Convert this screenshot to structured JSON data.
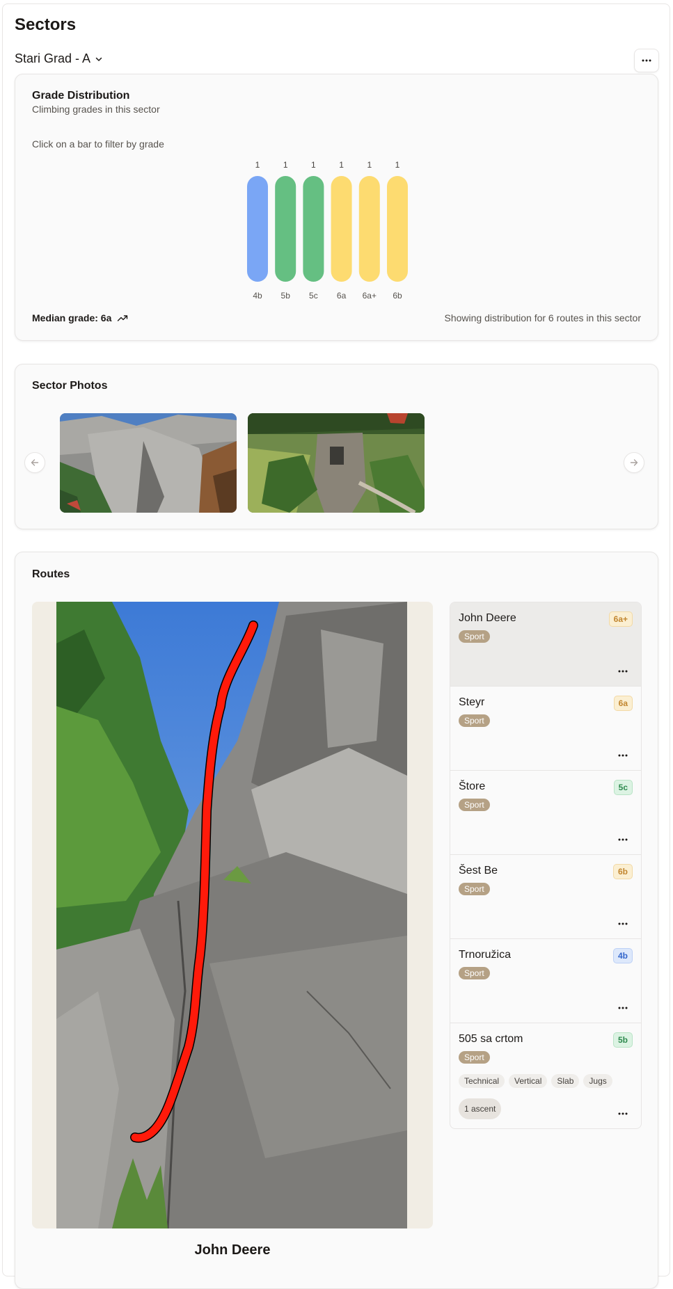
{
  "page": {
    "title": "Sectors"
  },
  "sector_selector": {
    "value": "Stari Grad - A"
  },
  "grade_distribution": {
    "title": "Grade Distribution",
    "subtitle": "Climbing grades in this sector",
    "hint": "Click on a bar to filter by grade",
    "median_label": "Median grade: 6a",
    "showing_text": "Showing distribution for 6 routes in this sector"
  },
  "chart_data": {
    "type": "bar",
    "categories": [
      "4b",
      "5b",
      "5c",
      "6a",
      "6a+",
      "6b"
    ],
    "values": [
      1,
      1,
      1,
      1,
      1,
      1
    ],
    "ylim": [
      0,
      1
    ],
    "grid": false,
    "colors": [
      "#7aa6f5",
      "#65bf82",
      "#65bf82",
      "#fddb70",
      "#fddb70",
      "#fddb70"
    ]
  },
  "photos": {
    "title": "Sector Photos",
    "prev_icon": "arrow-left-icon",
    "next_icon": "arrow-right-icon"
  },
  "routes": {
    "title": "Routes",
    "selected_name": "John Deere",
    "items": [
      {
        "name": "John Deere",
        "grade": "6a+",
        "grade_color": "#c2862f",
        "grade_bg": "#fbefd2",
        "type": "Sport"
      },
      {
        "name": "Steyr",
        "grade": "6a",
        "grade_color": "#c2862f",
        "grade_bg": "#fbefd2",
        "type": "Sport"
      },
      {
        "name": "Štore",
        "grade": "5c",
        "grade_color": "#2f8a4f",
        "grade_bg": "#dcf3e3",
        "type": "Sport"
      },
      {
        "name": "Šest Be",
        "grade": "6b",
        "grade_color": "#c2862f",
        "grade_bg": "#fbefd2",
        "type": "Sport"
      },
      {
        "name": "Trnoružica",
        "grade": "4b",
        "grade_color": "#3366cc",
        "grade_bg": "#dde8fb",
        "type": "Sport"
      },
      {
        "name": "505 sa crtom",
        "grade": "5b",
        "grade_color": "#2f8a4f",
        "grade_bg": "#dcf3e3",
        "type": "Sport",
        "tags": [
          "Technical",
          "Vertical",
          "Slab",
          "Jugs"
        ],
        "ascents": "1 ascent"
      }
    ]
  },
  "colors": {
    "accent_line": "#ff1a0a",
    "type_badge": "#b5a185"
  }
}
